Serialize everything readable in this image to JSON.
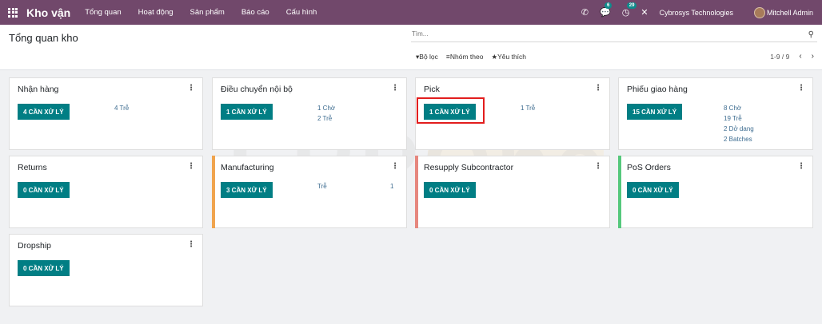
{
  "navbar": {
    "brand": "Kho vận",
    "menu": [
      "Tổng quan",
      "Hoạt động",
      "Sản phẩm",
      "Báo cáo",
      "Cấu hình"
    ],
    "messages_count": "6",
    "activities_count": "29",
    "company": "Cybrosys Technologies",
    "user": "Mitchell Admin"
  },
  "control": {
    "title": "Tổng quan kho",
    "search_placeholder": "Tìm...",
    "filter_label": "Bộ lọc",
    "groupby_label": "Nhóm theo",
    "favorites_label": "Yêu thích",
    "pager": "1-9 / 9"
  },
  "cards": [
    {
      "title": "Nhận hàng",
      "button": "4 CẦN XỬ LÝ",
      "stats": [
        "4 Trễ"
      ]
    },
    {
      "title": "Điều chuyển nội bộ",
      "button": "1 CẦN XỬ LÝ",
      "stats": [
        "1 Chờ",
        "2 Trễ"
      ]
    },
    {
      "title": "Pick",
      "button": "1 CẦN XỬ LÝ",
      "stats": [
        "1 Trễ"
      ]
    },
    {
      "title": "Phiếu giao hàng",
      "button": "15 CẦN XỬ LÝ",
      "stats": [
        "8 Chờ",
        "19 Trễ",
        "2 Dở dang",
        "2 Batches"
      ]
    },
    {
      "title": "Returns",
      "button": "0 CẦN XỬ LÝ",
      "stats": []
    },
    {
      "title": "Manufacturing",
      "button": "3 CẦN XỬ LÝ",
      "stats": [
        "Trễ"
      ],
      "stat_value": "1",
      "accent": "#f0a44e"
    },
    {
      "title": "Resupply Subcontractor",
      "button": "0 CẦN XỬ LÝ",
      "stats": [],
      "accent": "#e6877e"
    },
    {
      "title": "PoS Orders",
      "button": "0 CẦN XỬ LÝ",
      "stats": [],
      "accent": "#56c87c"
    },
    {
      "title": "Dropship",
      "button": "0 CẦN XỬ LÝ",
      "stats": []
    }
  ],
  "icons": {
    "apps": "apps-grid-icon",
    "phone": "phone-icon",
    "chat": "chat-icon",
    "activity": "clock-icon",
    "tools": "tools-icon",
    "kebab": "kebab-menu-icon",
    "search": "search-icon"
  },
  "watermark_text": "ERPOne",
  "colors": {
    "navbar": "#71486b",
    "button": "#017e84",
    "highlight": "#e21d1d"
  }
}
